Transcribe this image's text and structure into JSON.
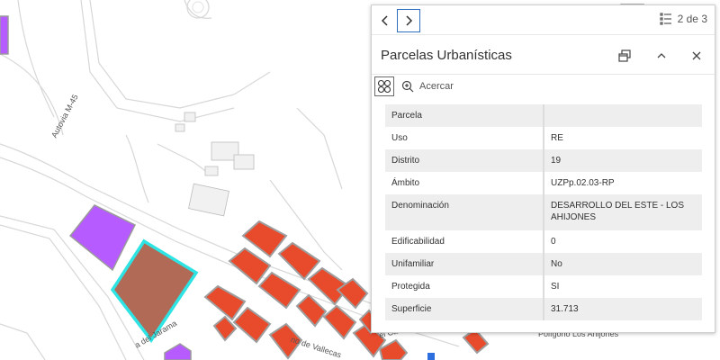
{
  "map": {
    "labels": {
      "road_m45": "Autovia M-45",
      "road_jarama": "a del Jarama",
      "road_vallecas": "no de Vallecas",
      "road_campo": "el Campo",
      "poligono": "Polígono  Los Ahijones"
    },
    "colors": {
      "parcel_red": "#e84a2c",
      "parcel_purple": "#b65bff",
      "selected_fill": "#b06a56",
      "selected_outline": "#2ee3e3"
    }
  },
  "popup": {
    "pager": {
      "count": "2 de 3"
    },
    "title": "Parcelas Urbanísticas",
    "toolbar": {
      "zoom_label": "Acercar"
    },
    "fields": [
      {
        "key": "Parcela",
        "value": ""
      },
      {
        "key": "Uso",
        "value": "RE"
      },
      {
        "key": "Distrito",
        "value": "19"
      },
      {
        "key": "Ámbito",
        "value": "UZPp.02.03-RP"
      },
      {
        "key": "Denominación",
        "value": "DESARROLLO DEL ESTE - LOS AHIJONES"
      },
      {
        "key": "Edificabilidad",
        "value": "0"
      },
      {
        "key": "Unifamiliar",
        "value": "No"
      },
      {
        "key": "Protegida",
        "value": "SI"
      },
      {
        "key": "Superficie",
        "value": "31.713"
      }
    ]
  }
}
